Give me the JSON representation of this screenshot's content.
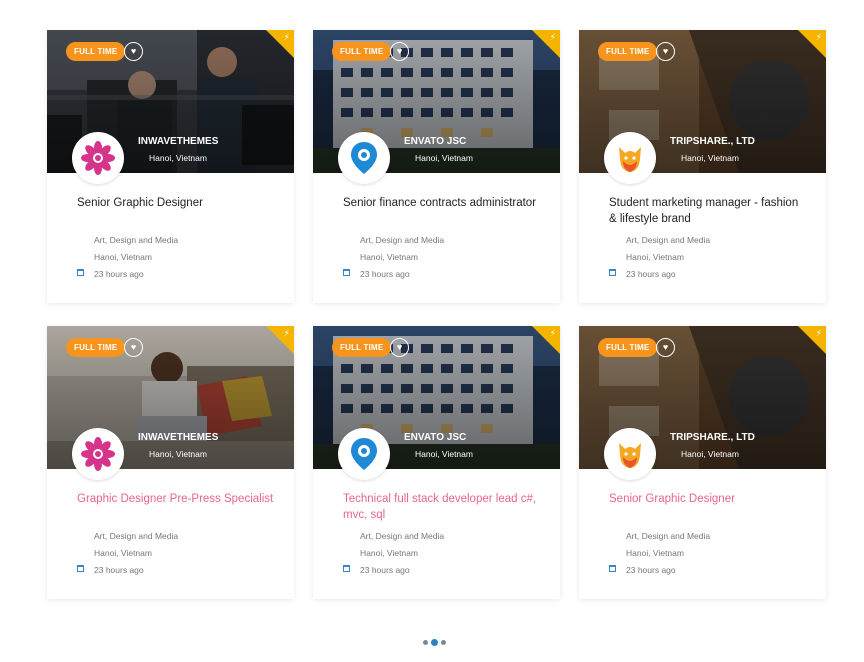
{
  "jobs": [
    {
      "badge": "FULL TIME",
      "company": "INWAVETHEMES",
      "hero_location": "Hanoi, Vietnam",
      "title": "Senior Graphic Designer",
      "category": "Art, Design and Media",
      "location": "Hanoi, Vietnam",
      "posted": "23 hours ago",
      "logo": "flower-logo-icon",
      "scene": "office"
    },
    {
      "badge": "FULL TIME",
      "company": "ENVATO JSC",
      "hero_location": "Hanoi, Vietnam",
      "title": "Senior finance contracts administrator",
      "category": "Art, Design and Media",
      "location": "Hanoi, Vietnam",
      "posted": "23 hours ago",
      "logo": "map-pin-logo-icon",
      "scene": "building"
    },
    {
      "badge": "FULL TIME",
      "company": "TRIPSHARE., LTD",
      "hero_location": "Hanoi, Vietnam",
      "title": "Student marketing manager - fashion & lifestyle brand",
      "category": "Art, Design and Media",
      "location": "Hanoi, Vietnam",
      "posted": "23 hours ago",
      "logo": "fox-logo-icon",
      "scene": "desk"
    },
    {
      "badge": "FULL TIME",
      "company": "INWAVETHEMES",
      "hero_location": "Hanoi, Vietnam",
      "title": "Graphic Designer Pre-Press Specialist",
      "category": "Art, Design and Media",
      "location": "Hanoi, Vietnam",
      "posted": "23 hours ago",
      "logo": "flower-logo-icon",
      "scene": "laptop"
    },
    {
      "badge": "FULL TIME",
      "company": "ENVATO JSC",
      "hero_location": "Hanoi, Vietnam",
      "title": "Technical full stack developer lead c#, mvc, sql",
      "category": "Art, Design and Media",
      "location": "Hanoi, Vietnam",
      "posted": "23 hours ago",
      "logo": "map-pin-logo-icon",
      "scene": "building"
    },
    {
      "badge": "FULL TIME",
      "company": "TRIPSHARE., LTD",
      "hero_location": "Hanoi, Vietnam",
      "title": "Senior Graphic Designer",
      "category": "Art, Design and Media",
      "location": "Hanoi, Vietnam",
      "posted": "23 hours ago",
      "logo": "fox-logo-icon",
      "scene": "desk"
    }
  ],
  "colors": {
    "badge": "#f6941d",
    "corner": "#f5b400",
    "title_pink": "#e8648f",
    "calendar": "#3b84c4",
    "dot_active": "#2f7fc1"
  },
  "pagination": {
    "pages": 3,
    "current": 2
  }
}
